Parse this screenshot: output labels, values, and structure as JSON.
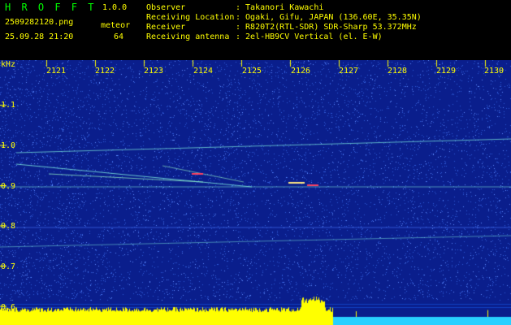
{
  "app": {
    "name": "H R O F F T",
    "version": "1.0.0"
  },
  "capture": {
    "filename": "2509282120.png",
    "datetime": "25.09.28 21:20",
    "meteor_label": "meteor",
    "meteor_count": "64"
  },
  "info": [
    {
      "key": "Observer",
      "value": ": Takanori Kawachi"
    },
    {
      "key": "Receiving Location",
      "value": ": Ogaki, Gifu, JAPAN (136.60E, 35.35N)"
    },
    {
      "key": "Receiver",
      "value": ": R820T2(RTL-SDR) SDR-Sharp 53.372MHz"
    },
    {
      "key": "Receiving antenna",
      "value": ": 2el-HB9CV Vertical (el. E-W)"
    }
  ],
  "spectrogram": {
    "freq_unit": "kHz",
    "time_ticks": [
      "2121",
      "2122",
      "2123",
      "2124",
      "2125",
      "2126",
      "2127",
      "2128",
      "2129",
      "2130"
    ],
    "freq_ticks": [
      "1.1",
      "1.0",
      "0.9",
      "0.8",
      "0.7",
      "0.6"
    ],
    "colors": {
      "background": "#0a1e8c",
      "noise": "#2f5ad8",
      "trace": "#7ff0e0",
      "meteor_peak": "#ff4060",
      "level_bar": "#ffff00",
      "baseline": "#28d0ff"
    }
  }
}
